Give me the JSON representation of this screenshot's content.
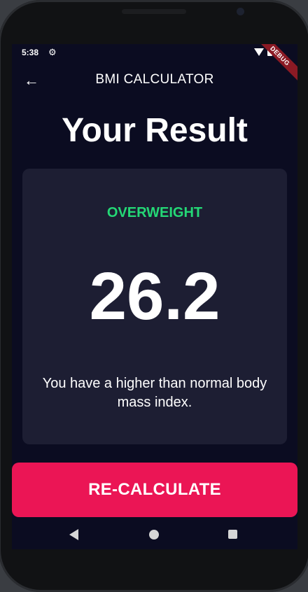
{
  "status_bar": {
    "time": "5:38",
    "settings_icon": "gear-icon",
    "wifi_icon": "wifi-icon",
    "battery_icon": "battery-icon",
    "debug_banner": "DEBUG"
  },
  "app_bar": {
    "back_icon": "back-arrow-icon",
    "back_glyph": "←",
    "title": "BMI CALCULATOR"
  },
  "page": {
    "title": "Your Result"
  },
  "result": {
    "status": "OVERWEIGHT",
    "bmi": "26.2",
    "interpretation": "You have a higher than normal body mass index."
  },
  "actions": {
    "recalculate_label": "RE-CALCULATE"
  },
  "nav_bar": {
    "back_icon": "nav-back-icon",
    "home_icon": "nav-home-icon",
    "recents_icon": "nav-recents-icon"
  },
  "colors": {
    "background": "#0b0c21",
    "card": "#1d1e33",
    "status_green": "#24d876",
    "accent_pink": "#eb1555"
  }
}
